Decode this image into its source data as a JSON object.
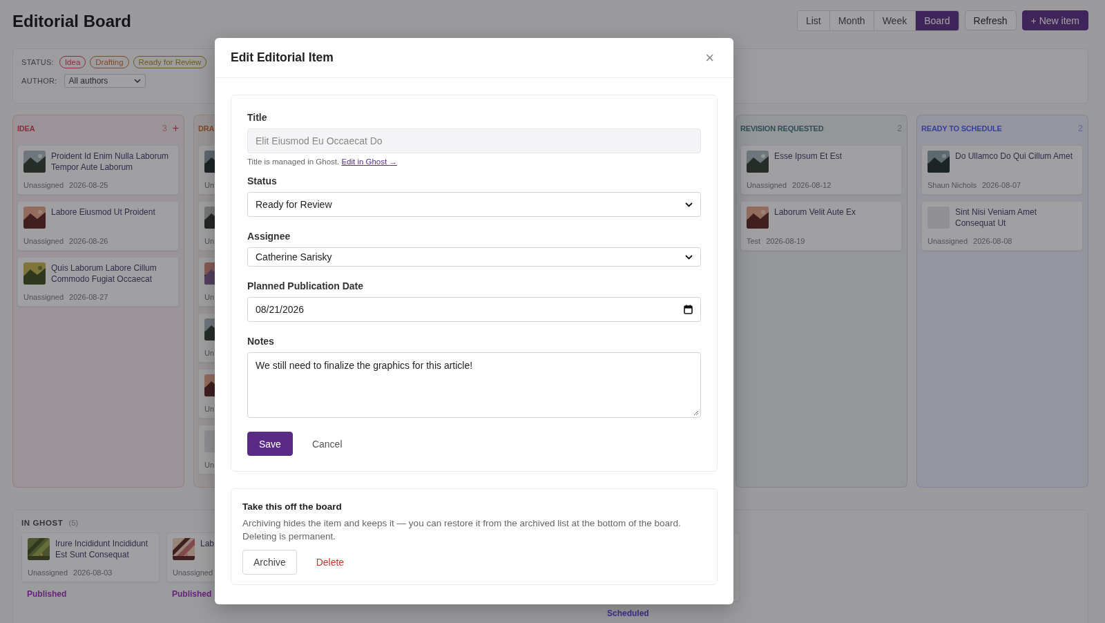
{
  "header": {
    "title": "Editorial Board",
    "views": [
      {
        "label": "List",
        "selected": false
      },
      {
        "label": "Month",
        "selected": false
      },
      {
        "label": "Week",
        "selected": false
      },
      {
        "label": "Board",
        "selected": true
      }
    ],
    "refresh": "Refresh",
    "new_item": "+ New item"
  },
  "filters": {
    "status_label": "STATUS:",
    "chips": [
      {
        "label": "Idea",
        "color": "#8f2a3e"
      },
      {
        "label": "Drafting",
        "color": "#7e4a2a"
      },
      {
        "label": "Ready for Review",
        "color": "#6b5a1e"
      }
    ],
    "author_label": "AUTHOR:",
    "author_select": "All authors"
  },
  "columns": [
    {
      "title": "IDEA",
      "color": "#8f2a3e",
      "count": "3",
      "add": "+",
      "cards": [
        {
          "kind": "picture",
          "title": "Proident Id Enim Nulla Laborum Tempor Aute Laborum",
          "assignee": "Unassigned",
          "date": "2026-08-25"
        },
        {
          "kind": "picture",
          "title": "Labore Eiusmod Ut Proident",
          "assignee": "Unassigned",
          "date": "2026-08-26"
        },
        {
          "kind": "picture",
          "title": "Quis Laborum Labore Cillum Commodo Fugiat Occaecat",
          "assignee": "Unassigned",
          "date": "2026-08-27"
        }
      ]
    },
    {
      "title": "DRA",
      "color": "#7e4a2a",
      "cards": [
        {
          "kind": "picture",
          "assignee": "Un"
        },
        {
          "kind": "picture",
          "assignee": "Un"
        },
        {
          "kind": "picture",
          "assignee": "Un"
        },
        {
          "kind": "picture",
          "assignee": "Un"
        },
        {
          "kind": "picture",
          "assignee": "Un"
        },
        {
          "kind": "blank",
          "assignee": "Un"
        }
      ]
    },
    {
      "title": "REVISION REQUESTED",
      "color": "#2e4f55",
      "count": "2",
      "cards": [
        {
          "kind": "picture",
          "title": "Esse Ipsum Et Est",
          "assignee": "Unassigned",
          "date": "2026-08-12"
        },
        {
          "kind": "picture",
          "title": "Laborum Velit Aute Ex",
          "assignee": "Test",
          "date": "2026-08-19"
        }
      ]
    },
    {
      "title": "READY TO SCHEDULE",
      "color": "#3640a0",
      "count": "2",
      "cards": [
        {
          "kind": "picture",
          "title": "Do Ullamco Do Qui Cillum Amet",
          "assignee": "Shaun Nichols",
          "date": "2026-08-07"
        },
        {
          "kind": "blank",
          "title": "Sint Nisi Veniam Amet Consequat Ut",
          "assignee": "Unassigned",
          "date": "2026-08-08"
        }
      ]
    }
  ],
  "in_ghost": {
    "title": "IN GHOST",
    "count": "(5)",
    "cards": [
      {
        "kind": "picture",
        "title": "Irure Incididunt Incididunt Est Sunt Consequat",
        "assignee": "Unassigned",
        "date": "2026-08-03",
        "status": "Published",
        "color": "#6a2080"
      },
      {
        "kind": "picture",
        "title": "Lab",
        "assignee": "Unassigned",
        "status": "Published",
        "color": "#6a2080"
      },
      {
        "kind": "covered",
        "status": "Scheduled",
        "color": "#3a3090"
      }
    ]
  },
  "modal": {
    "title": "Edit Editorial Item",
    "close": "×",
    "fields": [
      {
        "kind": "text",
        "label": "Title",
        "value": "Elit Eiusmod Eu Occaecat Do",
        "disabled": true,
        "hint": "Title is managed in Ghost.",
        "hint_link": "Edit in Ghost →"
      },
      {
        "kind": "select",
        "label": "Status",
        "value": "Ready for Review"
      },
      {
        "kind": "select",
        "label": "Assignee",
        "value": "Catherine Sarisky"
      },
      {
        "kind": "date",
        "label": "Planned Publication Date",
        "value": "08/21/2026"
      },
      {
        "kind": "textarea",
        "label": "Notes",
        "value": "We still need to finalize the graphics for this article!"
      }
    ],
    "save": "Save",
    "cancel": "Cancel",
    "danger": {
      "title": "Take this off the board",
      "text": "Archiving hides the item and keeps it — you can restore it from the archived list at the bottom of the board. Deleting is permanent.",
      "archive": "Archive",
      "delete": "Delete"
    }
  }
}
